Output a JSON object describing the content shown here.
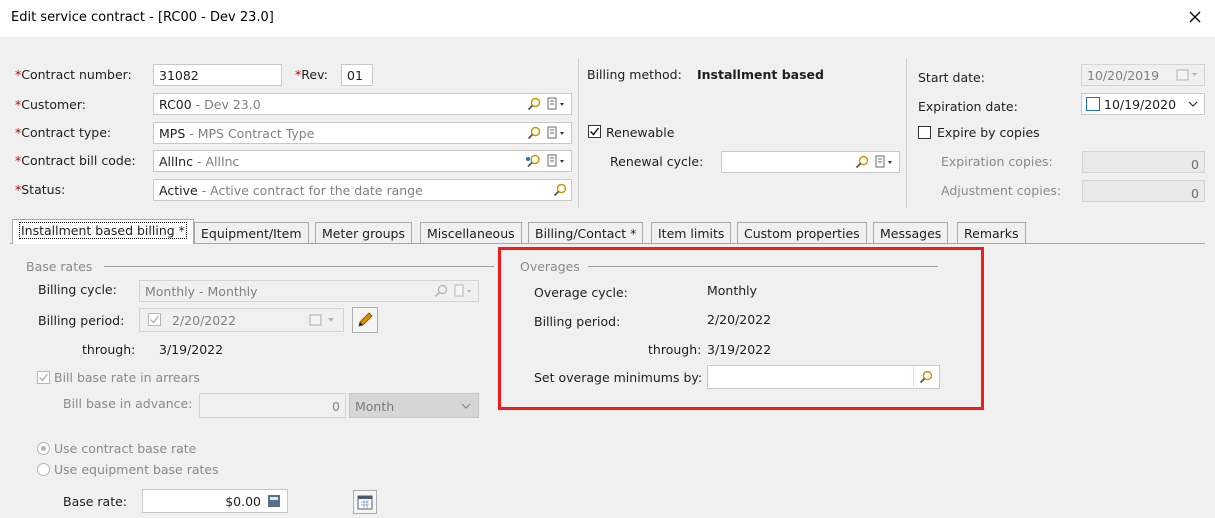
{
  "window": {
    "title": "Edit service contract - [RC00 - Dev 23.0]"
  },
  "header": {
    "contract_number_label": "Contract number:",
    "contract_number": "31082",
    "rev_label": "Rev:",
    "rev": "01",
    "customer_label": "Customer:",
    "customer_code": "RC00",
    "customer_name": " - Dev 23.0",
    "contract_type_label": "Contract type:",
    "contract_type_code": "MPS",
    "contract_type_name": " - MPS Contract Type",
    "bill_code_label": "Contract bill code:",
    "bill_code_code": "AllInc",
    "bill_code_name": " - AllInc",
    "status_label": "Status:",
    "status_code": "Active",
    "status_name": " - Active contract for the date range",
    "required_mark": "*"
  },
  "billing": {
    "method_label": "Billing method:",
    "method_value": "Installment based",
    "renewable_label": "Renewable",
    "renewable_checked": true,
    "renewal_cycle_label": "Renewal cycle:",
    "renewal_cycle_value": ""
  },
  "dates": {
    "start_label": "Start date:",
    "start_value": "10/20/2019",
    "expiration_label": "Expiration date:",
    "expiration_value": "10/19/2020",
    "expire_by_copies_label": "Expire by copies",
    "expiration_copies_label": "Expiration copies:",
    "expiration_copies_value": "0",
    "adjustment_copies_label": "Adjustment copies:",
    "adjustment_copies_value": "0"
  },
  "tabs": [
    {
      "label": "Installment based billing *",
      "active": true
    },
    {
      "label": "Equipment/Item"
    },
    {
      "label": "Meter groups"
    },
    {
      "label": "Miscellaneous"
    },
    {
      "label": "Billing/Contact *"
    },
    {
      "label": "Item limits"
    },
    {
      "label": "Custom properties"
    },
    {
      "label": "Messages"
    },
    {
      "label": "Remarks"
    }
  ],
  "base_rates": {
    "group_label": "Base rates",
    "billing_cycle_label": "Billing cycle:",
    "billing_cycle_value": "Monthly - Monthly",
    "billing_period_label": "Billing period:",
    "billing_period_value": "2/20/2022",
    "through_label": "through:",
    "through_value": "3/19/2022",
    "bill_in_arrears_label": "Bill base rate in arrears",
    "bill_in_advance_label": "Bill base in advance:",
    "bill_in_advance_value": "0",
    "advance_unit": "Month",
    "use_contract_rate_label": "Use contract base rate",
    "use_equipment_rates_label": "Use equipment base rates",
    "base_rate_label": "Base rate:",
    "base_rate_value": "$0.00"
  },
  "overages": {
    "group_label": "Overages",
    "cycle_label": "Overage cycle:",
    "cycle_value": "Monthly",
    "period_label": "Billing period:",
    "period_value": "2/20/2022",
    "through_label": "through:",
    "through_value": "3/19/2022",
    "minimums_label": "Set overage minimums by:",
    "minimums_value": ""
  },
  "colors": {
    "highlight_box": "#ee1c1c",
    "required": "#c00000",
    "accent": "#1e73be"
  }
}
